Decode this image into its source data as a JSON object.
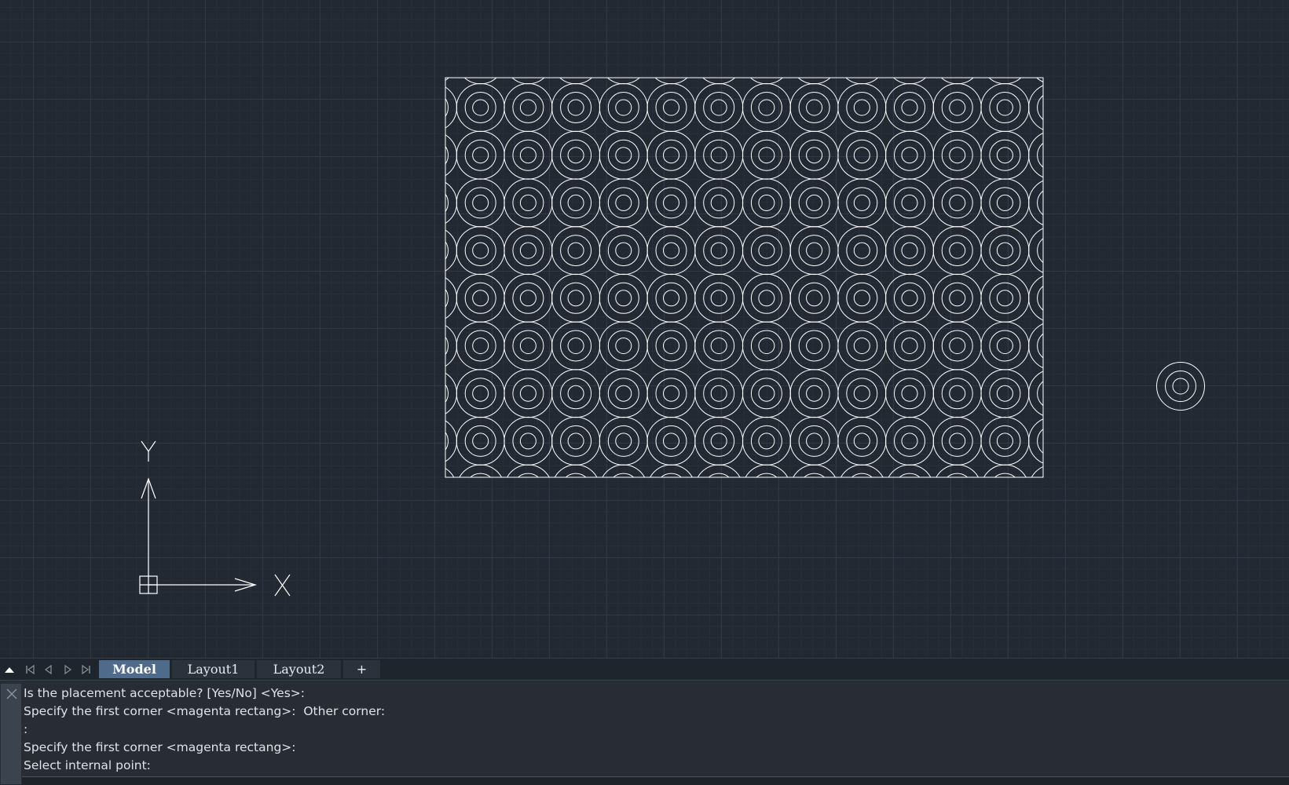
{
  "viewport": {
    "ucs": {
      "x_label": "X",
      "y_label": "Y"
    },
    "pattern": {
      "rows": 8,
      "cols": 13
    },
    "colors": {
      "background": "#222933",
      "lines": "#ffffff",
      "grid": "#2f3844"
    }
  },
  "layout_tabs": {
    "nav": [
      "scroll-up",
      "first",
      "previous",
      "next",
      "last"
    ],
    "tabs": [
      {
        "label": "Model",
        "active": true
      },
      {
        "label": "Layout1",
        "active": false
      },
      {
        "label": "Layout2",
        "active": false
      }
    ],
    "add_label": "+"
  },
  "command_line": {
    "history": [
      "Is the placement acceptable? [Yes/No] <Yes>:",
      "Specify the first corner <magenta rectang>:  Other corner:",
      ":",
      "Specify the first corner <magenta rectang>:",
      "Select internal point:"
    ],
    "input_value": ""
  }
}
